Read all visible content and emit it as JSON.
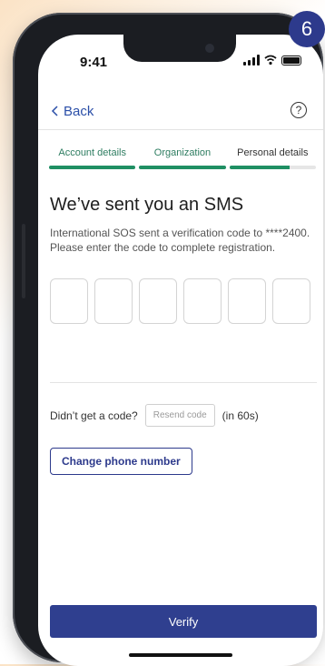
{
  "status_bar": {
    "time": "9:41"
  },
  "step_badge": "6",
  "nav": {
    "back_label": "Back",
    "help_label": "?"
  },
  "steps": [
    {
      "label": "Account details",
      "progress": 1.0,
      "active": true
    },
    {
      "label": "Organization",
      "progress": 1.0,
      "active": true
    },
    {
      "label": "Personal details",
      "progress": 0.7,
      "active": false
    }
  ],
  "content": {
    "title": "We’ve sent you an SMS",
    "description": "International SOS sent a verification code to ****2400. Please enter the code to complete registration."
  },
  "code_inputs": [
    "",
    "",
    "",
    "",
    "",
    ""
  ],
  "resend": {
    "prompt": "Didn’t get a code?",
    "button_label": "Resend code",
    "timer": "(in 60s)"
  },
  "change_phone_label": "Change phone number",
  "verify_label": "Verify",
  "colors": {
    "primary": "#2f3f8f",
    "accent_green": "#1f8f63",
    "link_blue": "#2b4fa8"
  }
}
